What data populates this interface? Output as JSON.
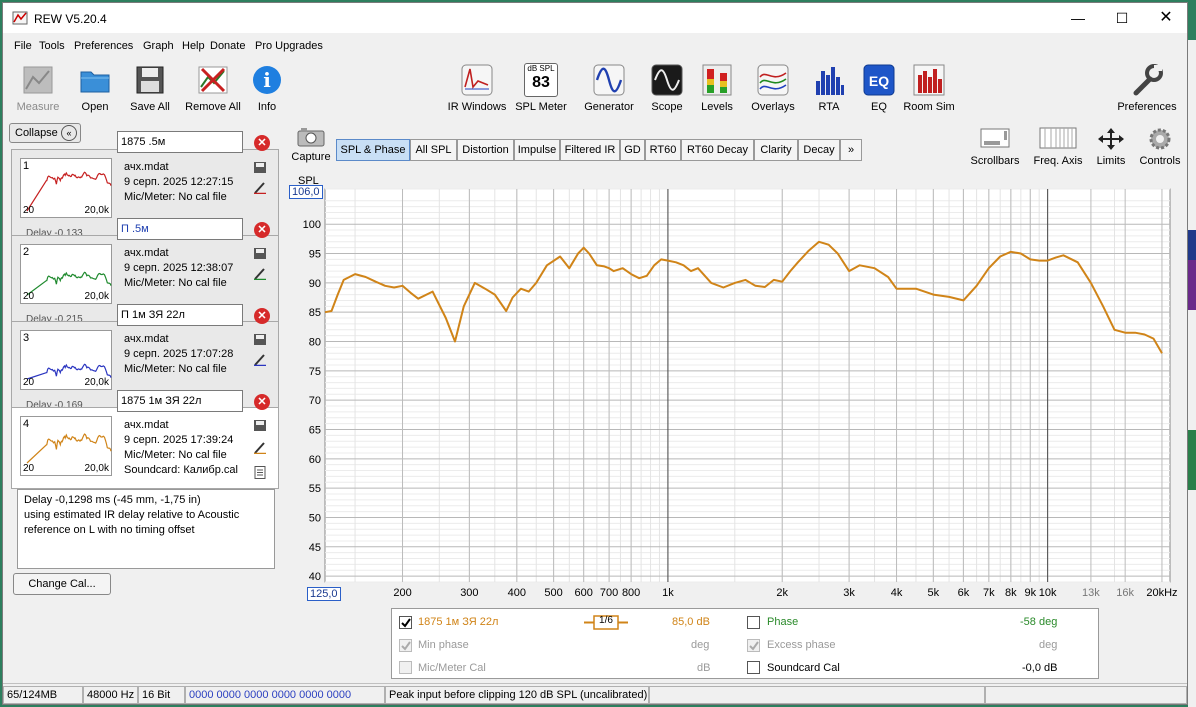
{
  "window": {
    "title": "REW V5.20.4",
    "minimize_icon": "minimize-icon",
    "maximize_icon": "maximize-icon",
    "close_icon": "close-icon"
  },
  "menu": [
    "File",
    "Tools",
    "Preferences",
    "Graph",
    "Help",
    "Donate",
    "Pro Upgrades"
  ],
  "toolbar_left": [
    {
      "label": "Measure",
      "icon": "microphone-icon",
      "disabled": true
    },
    {
      "label": "Open",
      "icon": "folder-icon"
    },
    {
      "label": "Save All",
      "icon": "floppy-disk-icon"
    },
    {
      "label": "Remove All",
      "icon": "remove-all-icon"
    },
    {
      "label": "Info",
      "icon": "info-icon"
    }
  ],
  "toolbar_center": [
    {
      "label": "IR Windows",
      "icon": "ir-windows-icon"
    },
    {
      "label": "SPL Meter",
      "icon": "spl-meter-icon",
      "badge_top": "dB SPL",
      "badge_value": "83"
    },
    {
      "label": "Generator",
      "icon": "generator-icon"
    },
    {
      "label": "Scope",
      "icon": "scope-icon"
    },
    {
      "label": "Levels",
      "icon": "levels-icon"
    },
    {
      "label": "Overlays",
      "icon": "overlays-icon"
    },
    {
      "label": "RTA",
      "icon": "rta-icon"
    },
    {
      "label": "EQ",
      "icon": "eq-icon"
    },
    {
      "label": "Room Sim",
      "icon": "room-sim-icon"
    }
  ],
  "preferences": {
    "label": "Preferences",
    "icon": "wrench-icon"
  },
  "collapse_label": "Collapse",
  "measurements": [
    {
      "num": "1",
      "name": "1875 .5м",
      "file": "ачх.mdat",
      "date": "9 серп. 2025 12:27:15",
      "mic": "Mic/Meter: No cal file",
      "lo": "20",
      "hi": "20,0k",
      "color": "#c62020",
      "delay_fragment": "Delay -0,133"
    },
    {
      "num": "2",
      "name": "П .5м",
      "file": "ачх.mdat",
      "date": "9 серп. 2025 12:38:07",
      "mic": "Mic/Meter: No cal file",
      "lo": "20",
      "hi": "20,0k",
      "color": "#1f8a2e",
      "delay_fragment": "Delay -0,215"
    },
    {
      "num": "3",
      "name": "П 1м ЗЯ 22л",
      "file": "ачх.mdat",
      "date": "9 серп. 2025 17:07:28",
      "mic": "Mic/Meter: No cal file",
      "lo": "20",
      "hi": "20,0k",
      "color": "#2a35c0",
      "delay_fragment": "Delay -0,169"
    },
    {
      "num": "4",
      "name": "1875 1м ЗЯ 22л",
      "file": "ачх.mdat",
      "date": "9 серп. 2025 17:39:24",
      "mic": "Mic/Meter: No cal file",
      "soundcard": "Soundcard: Калибр.cal",
      "lo": "20",
      "hi": "20,0k",
      "color": "#d08418"
    }
  ],
  "notes": [
    "Delay -0,1298 ms (-45 mm, -1,75 in)",
    "using estimated IR delay relative to Acoustic",
    "reference on  L with no timing offset"
  ],
  "change_cal_label": "Change Cal...",
  "capture": {
    "label": "Capture",
    "icon": "camera-icon"
  },
  "tabs": [
    "SPL & Phase",
    "All SPL",
    "Distortion",
    "Impulse",
    "Filtered IR",
    "GD",
    "RT60",
    "RT60 Decay",
    "Clarity",
    "Decay",
    "»"
  ],
  "active_tab": "SPL & Phase",
  "right_controls": [
    {
      "label": "Scrollbars",
      "icon": "scrollbars-icon"
    },
    {
      "label": "Freq. Axis",
      "icon": "freq-axis-icon"
    },
    {
      "label": "Limits",
      "icon": "limits-icon"
    },
    {
      "label": "Controls",
      "icon": "controls-gear-icon"
    }
  ],
  "legend": {
    "trace_name": "1875 1м ЗЯ 22л",
    "smoothing": "1/6",
    "trace_value": "85,0 dB",
    "phase_label": "Phase",
    "phase_value": "-58 deg",
    "min_phase_label": "Min phase",
    "min_phase_unit": "deg",
    "excess_phase_label": "Excess phase",
    "excess_phase_unit": "deg",
    "mic_cal_label": "Mic/Meter Cal",
    "mic_cal_unit": "dB",
    "soundcard_cal_label": "Soundcard Cal",
    "soundcard_cal_value": "-0,0 dB",
    "trace_color": "#d08418",
    "phase_color": "#2a8a2a"
  },
  "status": {
    "memory": "65/124MB",
    "rate": "48000 Hz",
    "bits": "16 Bit",
    "levels": "0000 0000   0000 0000   0000 0000",
    "message": "Peak input before clipping 120 dB SPL (uncalibrated)"
  },
  "chart_data": {
    "type": "line",
    "ylabel": "SPL",
    "xscale": "log",
    "xlim": [
      125,
      21000
    ],
    "ylim": [
      39,
      106
    ],
    "x_top_readout": "106,0",
    "x_left_readout": "125,0",
    "yticks": [
      40,
      45,
      50,
      55,
      60,
      65,
      70,
      75,
      80,
      85,
      90,
      95,
      100
    ],
    "ytick_labels": [
      "40",
      "45",
      "50",
      "55",
      "60",
      "65",
      "70",
      "75",
      "80",
      "85",
      "90",
      "95",
      "100"
    ],
    "xticks": [
      200,
      300,
      400,
      500,
      600,
      700,
      800,
      1000,
      2000,
      3000,
      4000,
      5000,
      6000,
      7000,
      8000,
      9000,
      10000,
      13000,
      16000,
      20000
    ],
    "xtick_labels": [
      "200",
      "300",
      "400",
      "500",
      "600",
      "700",
      "800",
      "1k",
      "2k",
      "3k",
      "4k",
      "5k",
      "6k",
      "7k",
      "8k",
      "9k",
      "10k",
      "13k",
      "16k",
      "20kHz"
    ],
    "series": [
      {
        "color": "#d08418",
        "x": [
          125,
          130,
          135,
          140,
          150,
          160,
          170,
          180,
          190,
          200,
          210,
          220,
          240,
          260,
          275,
          290,
          310,
          330,
          350,
          375,
          390,
          410,
          430,
          450,
          480,
          520,
          550,
          580,
          600,
          620,
          650,
          680,
          700,
          720,
          760,
          800,
          840,
          880,
          920,
          960,
          1000,
          1050,
          1100,
          1150,
          1200,
          1300,
          1400,
          1500,
          1600,
          1700,
          1800,
          1900,
          2000,
          2100,
          2200,
          2350,
          2500,
          2650,
          2800,
          3000,
          3200,
          3500,
          3800,
          4000,
          4500,
          5000,
          5500,
          6000,
          6500,
          7000,
          7500,
          8000,
          8500,
          9000,
          9500,
          10000,
          10500,
          11000,
          12000,
          13000,
          14000,
          15000,
          16000,
          17000,
          18000,
          19000,
          20000
        ],
        "y": [
          85,
          85.2,
          88,
          90.5,
          91.5,
          91,
          90.2,
          89.5,
          89.2,
          89.5,
          88.3,
          87.3,
          88.5,
          84,
          80,
          86,
          90,
          89,
          88,
          85.2,
          87.5,
          89,
          88.5,
          90,
          93,
          94.5,
          92.5,
          95,
          96,
          95,
          93,
          92.8,
          92.5,
          92,
          92.5,
          91.5,
          90.8,
          91.2,
          93,
          94,
          93.8,
          93.5,
          93,
          92,
          92.5,
          90,
          89.2,
          90,
          90.5,
          89.5,
          89.3,
          90.5,
          90.2,
          92,
          93.5,
          95.5,
          97,
          96.5,
          95,
          92,
          93,
          92.5,
          91,
          89,
          89,
          88,
          87.6,
          87,
          89.5,
          92.5,
          94.5,
          95.3,
          95,
          94,
          93.8,
          93.8,
          94.3,
          94.7,
          93.5,
          90,
          86,
          82,
          81.5,
          81.5,
          81.2,
          80.5,
          78
        ]
      }
    ]
  }
}
